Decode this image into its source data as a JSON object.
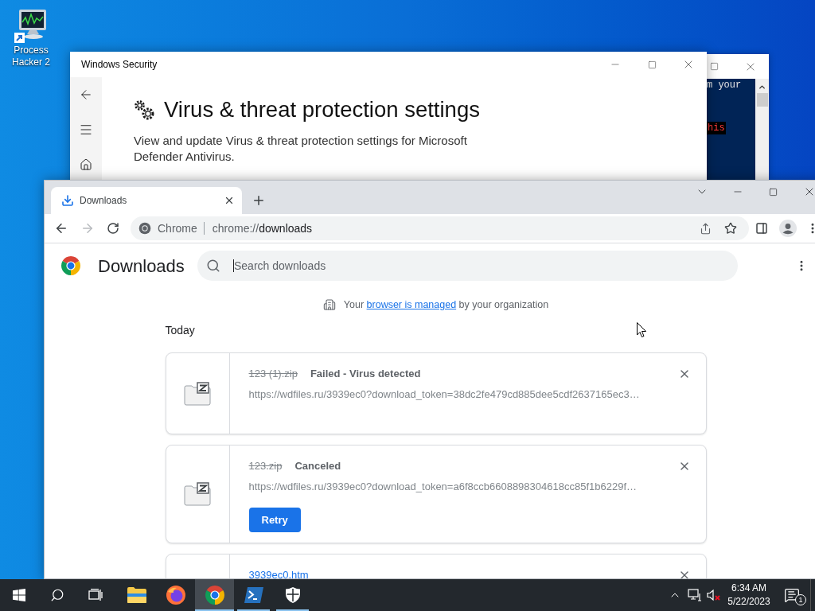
{
  "desktop": {
    "icons": [
      {
        "label": "Process Hacker 2"
      }
    ]
  },
  "console_window": {
    "lines": [
      {
        "text": "m your",
        "kind": "output"
      },
      {
        "text": "his",
        "kind": "error"
      }
    ]
  },
  "security_window": {
    "title": "Windows Security",
    "heading": "Virus & threat protection settings",
    "description": "View and update Virus & threat protection settings for Microsoft Defender Antivirus."
  },
  "browser": {
    "tabs": [
      {
        "label": "Downloads",
        "selected": true
      }
    ],
    "toolbar": {
      "forward_disabled": true
    },
    "omnibox": {
      "site_label": "Chrome",
      "url_scheme": "chrome://",
      "url_path": "downloads"
    },
    "page": {
      "title": "Downloads",
      "search": {
        "placeholder": "Search downloads",
        "focused": true
      },
      "managed_notice": {
        "before": "Your",
        "link": "browser is managed",
        "after": "by your organization"
      },
      "section": "Today",
      "downloads": [
        {
          "file_name": "123 (1).zip",
          "struck": true,
          "status": "Failed - Virus detected",
          "url": "https://wdfiles.ru/3939ec0?download_token=38dc2fe479cd885dee5cdf2637165ec3…"
        },
        {
          "file_name": "123.zip",
          "struck": true,
          "status": "Canceled",
          "url": "https://wdfiles.ru/3939ec0?download_token=a6f8ccb6608898304618cc85f1b6229f…",
          "action": "Retry"
        },
        {
          "file_name": "3939ec0.htm",
          "struck": false
        }
      ]
    }
  },
  "taskbar": {
    "apps": [
      {
        "kind": "folder",
        "running": false,
        "selected": false
      },
      {
        "kind": "firefox",
        "running": false,
        "selected": false
      },
      {
        "kind": "chrome",
        "running": true,
        "selected": true
      },
      {
        "kind": "terminal",
        "running": true,
        "selected": false
      },
      {
        "kind": "shield",
        "running": true,
        "selected": false
      }
    ],
    "volume_muted": true,
    "clock": {
      "time": "6:34 AM",
      "date": "5/22/2023"
    },
    "notification_count": "1"
  }
}
